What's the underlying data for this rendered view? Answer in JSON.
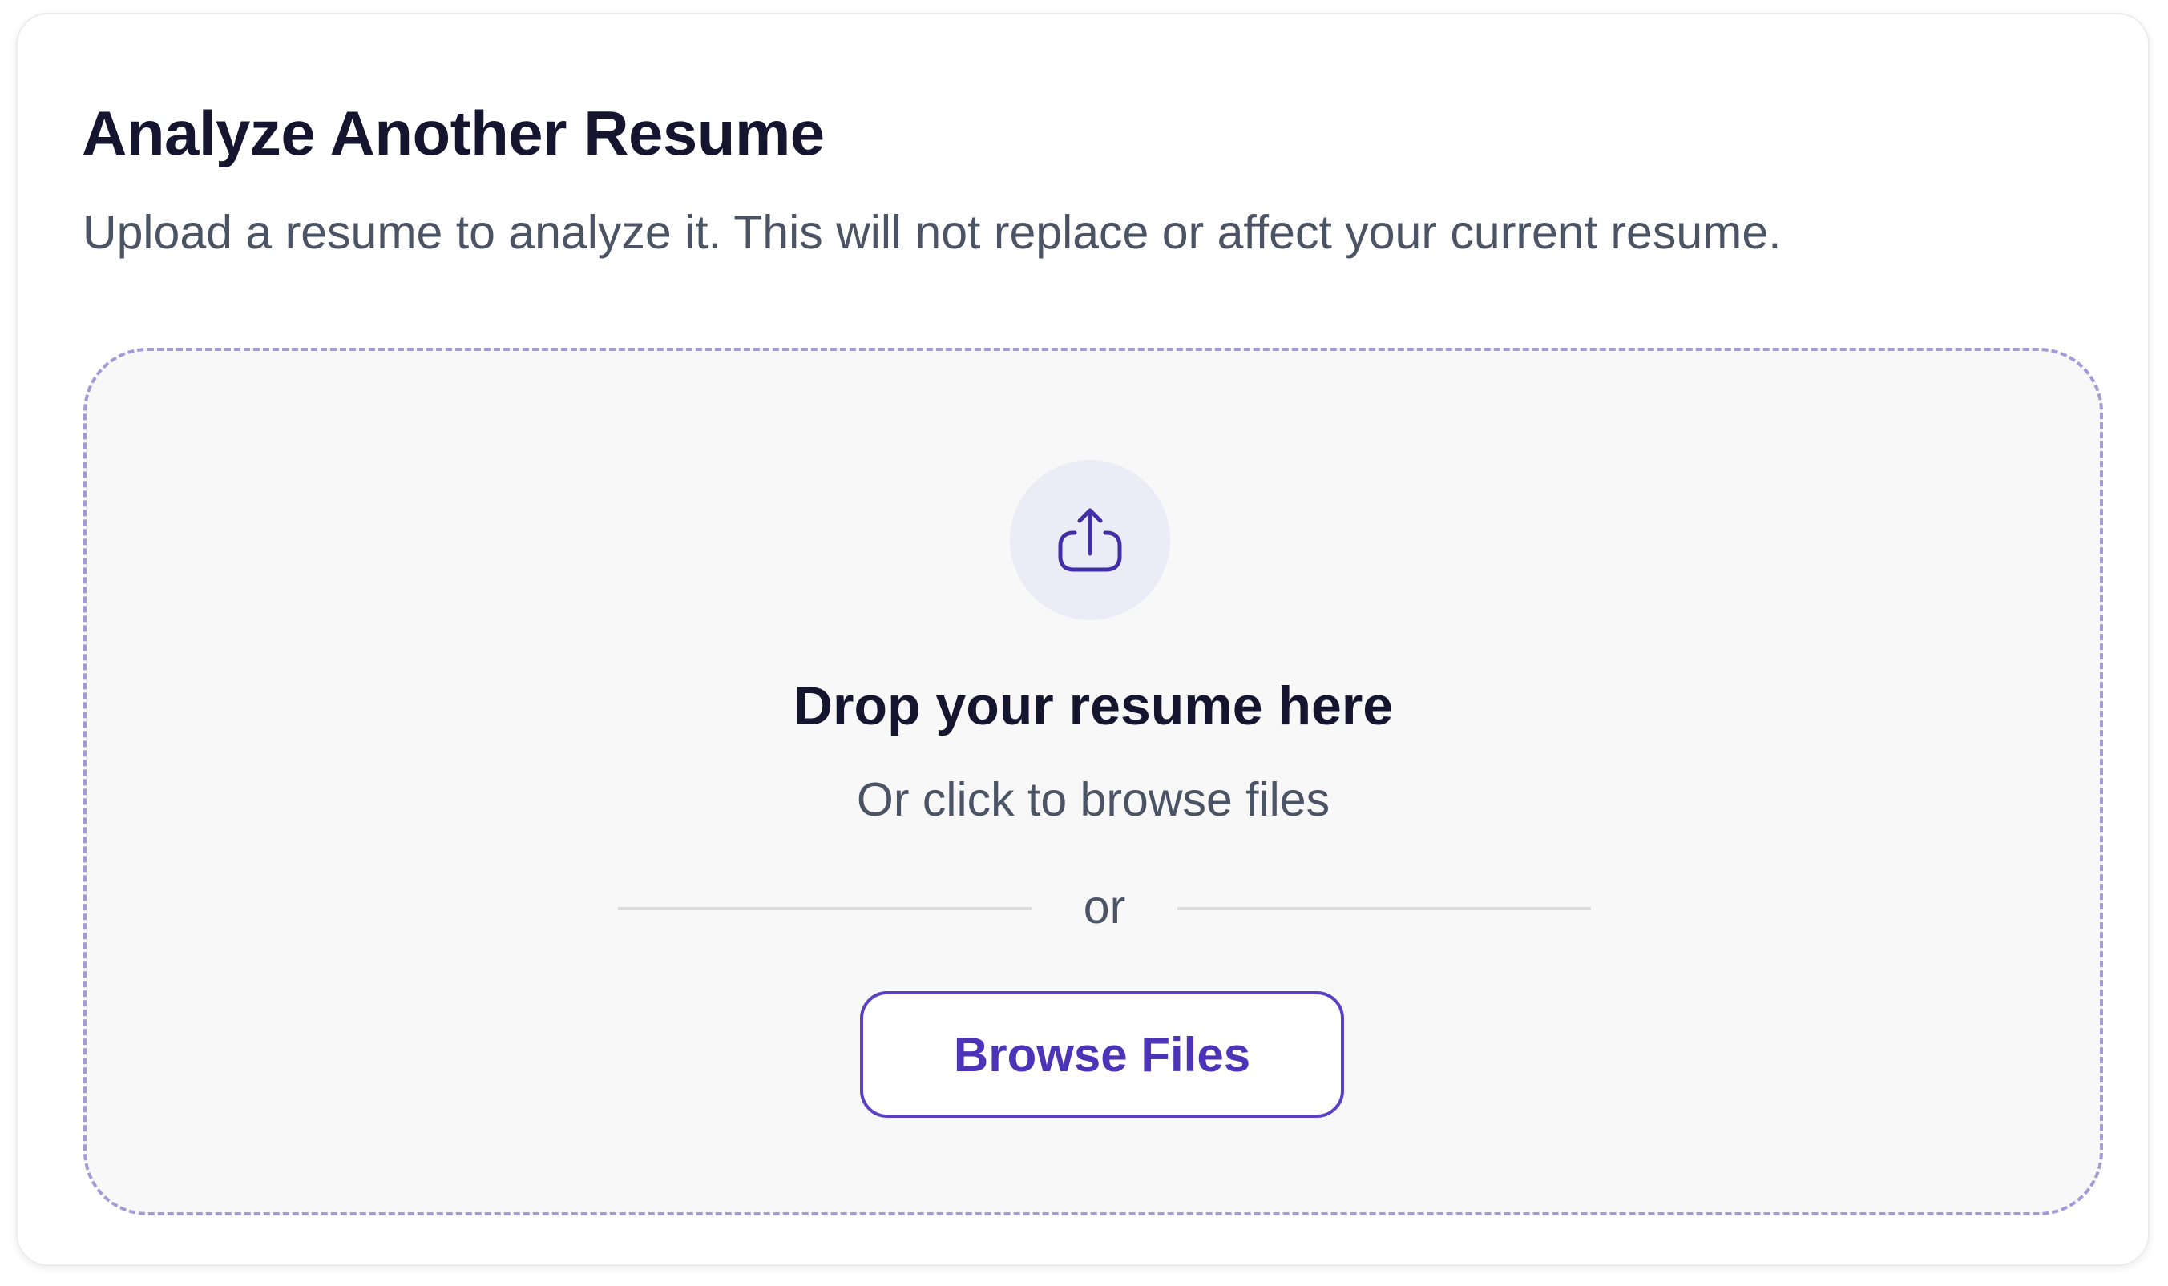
{
  "card": {
    "title": "Analyze Another Resume",
    "subtitle": "Upload a resume to analyze it. This will not replace or affect your current resume."
  },
  "dropzone": {
    "icon": "upload-icon",
    "heading": "Drop your resume here",
    "hint": "Or click to browse files",
    "separator": "or",
    "browse_label": "Browse Files"
  },
  "colors": {
    "accent": "#5a3fc2",
    "accent_text": "#4c34b8",
    "heading": "#15152f",
    "body_text": "#4b5465",
    "dropzone_border": "#a49ad6",
    "dropzone_bg": "#f8f8f8",
    "icon_circle_bg": "#ececf6"
  }
}
